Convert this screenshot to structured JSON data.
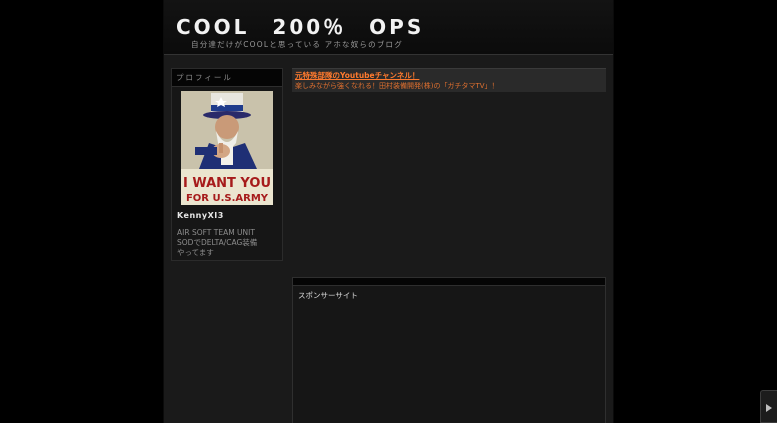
{
  "header": {
    "title": "COOL　200％　OPS",
    "description": "自分達だけがCOOLと思っている アホな奴らのブログ"
  },
  "sidebar": {
    "heading": "プロフィール",
    "profile": {
      "image_text_top": "I WANT YOU",
      "image_text_bottom": "FOR U.S.ARMY",
      "name": "KennyXI3",
      "description": [
        "AIR SOFT TEAM UNIT",
        "SODでDELTA/CAG装備",
        "やってます"
      ]
    }
  },
  "main": {
    "notice": {
      "link": "元特殊部隊のYoutubeチャンネル！",
      "text": "楽しみながら強くなれる！田村装備開発(株)の「ガチタマTV」！"
    },
    "sponsor": {
      "title": "スポンサーサイト"
    }
  },
  "colors": {
    "accent": "#ff7a2e",
    "background": "#000000",
    "panel": "#1a1a1a"
  },
  "icons": {
    "scroll": "play-arrow-icon"
  }
}
